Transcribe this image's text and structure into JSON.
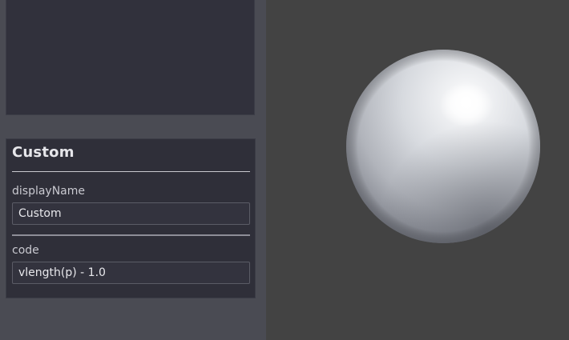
{
  "node": {
    "title": "Custom",
    "fields": [
      {
        "label": "displayName",
        "value": "Custom"
      },
      {
        "label": "code",
        "value": "vlength(p) - 1.0"
      }
    ]
  },
  "viewport": {
    "background_color": "#434343",
    "preview": "sphere"
  },
  "colors": {
    "panel_bg": "#4a4b53",
    "box_bg": "#2f2f39",
    "text": "#e6e6ea"
  }
}
